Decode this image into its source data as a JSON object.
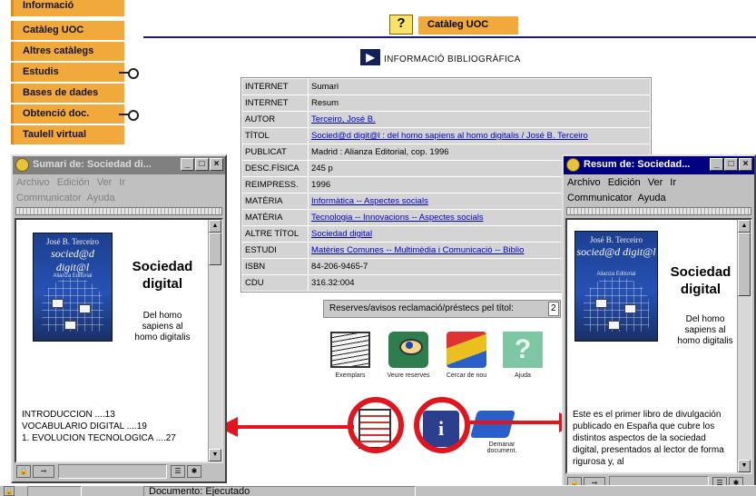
{
  "nav": {
    "items": [
      {
        "label": "Informació"
      },
      {
        "label": "Catàleg UOC"
      },
      {
        "label": "Altres catàlegs"
      },
      {
        "label": "Estudis"
      },
      {
        "label": "Bases de dades"
      },
      {
        "label": "Obtenció doc."
      },
      {
        "label": "Taulell virtual"
      }
    ]
  },
  "header": {
    "help_glyph": "?",
    "tab": "Catàleg UOC",
    "info_title": "INFORMACIÓ BIBLIOGRÀFICA"
  },
  "record": {
    "rows": [
      {
        "key": "INTERNET",
        "value": "Sumari"
      },
      {
        "key": "INTERNET",
        "value": "Resum"
      },
      {
        "key": "AUTOR",
        "value": "Terceiro, José B."
      },
      {
        "key": "TÍTOL",
        "value": "Socied@d digit@l : del homo sapiens al homo digitalis / José B. Terceiro"
      },
      {
        "key": "PUBLICAT",
        "value": "Madrid : Alianza Editorial, cop. 1996"
      },
      {
        "key": "DESC.FÍSICA",
        "value": "245 p"
      },
      {
        "key": "REIMPRESS.",
        "value": "1996"
      },
      {
        "key": "MATÈRIA",
        "value": "Informàtica -- Aspectes socials"
      },
      {
        "key": "MATÈRIA",
        "value": "Tecnologia -- Innovacions -- Aspectes socials"
      },
      {
        "key": "ALTRE TÍTOL",
        "value": "Sociedad digital"
      },
      {
        "key": "ESTUDI",
        "value": "Matèries Comunes -- Multimèdia i Comunicació -- Biblio"
      },
      {
        "key": "ISBN",
        "value": "84-206-9465-7"
      },
      {
        "key": "CDU",
        "value": "316.32:004"
      }
    ],
    "reserves_label": "Reserves/avisos reclamació/préstecs pel títol:",
    "reserves_count": "2"
  },
  "actions": [
    {
      "label": "Exemplars",
      "icon": "stack-of-papers-icon"
    },
    {
      "label": "Veure reserves",
      "icon": "eye-icon"
    },
    {
      "label": "Cercar de nou",
      "icon": "books-icon"
    },
    {
      "label": "Ajuda",
      "icon": "help-question-icon"
    }
  ],
  "order": {
    "label": "Demanar document."
  },
  "win_summary": {
    "title": "Sumari de: Sociedad di...",
    "menu": [
      "Archivo",
      "Edición",
      "Ver",
      "Ir"
    ],
    "menu2": [
      "Communicator",
      "Ayuda"
    ],
    "cover_author": "José B. Terceiro",
    "cover_title": "socied@d digit@l",
    "cover_pub": "Alianza Editorial",
    "book_title": "Sociedad digital",
    "book_sub": "Del homo sapiens al homo digitalis",
    "toc": [
      "INTRODUCCION ....13",
      "VOCABULARIO DIGITAL ....19",
      "",
      "1. EVOLUCION TECNOLOGICA ....27"
    ]
  },
  "win_resum": {
    "title": "Resum de: Sociedad...",
    "menu": [
      "Archivo",
      "Edición",
      "Ver",
      "Ir"
    ],
    "menu2": [
      "Communicator",
      "Ayuda"
    ],
    "cover_author": "José B. Terceiro",
    "cover_title": "socied@d digit@l",
    "cover_pub": "Alianza Editorial",
    "book_title": "Sociedad digital",
    "book_sub": "Del homo sapiens al homo digitalis",
    "desc": "Este es el primer libro de divulgación publicado en España que cubre los distintos aspectos de la sociedad digital, presentados al lector de forma rigurosa y, al"
  },
  "status": {
    "text": "Documento: Ejecutado"
  },
  "colors": {
    "nav": "#f2a93b",
    "accent_red": "#e2141d",
    "titlebar_active": "#000080"
  }
}
